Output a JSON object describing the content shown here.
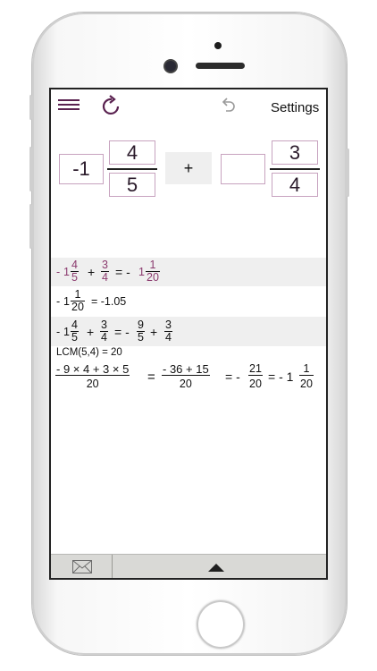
{
  "topbar": {
    "settings_label": "Settings"
  },
  "input": {
    "whole1": "-1",
    "num1": "4",
    "den1": "5",
    "operator": "+",
    "whole2": "",
    "num2": "3",
    "den2": "4"
  },
  "result": {
    "row1": {
      "minus": "-",
      "w": "1",
      "n1": "4",
      "d1": "5",
      "plus": "+",
      "n2": "3",
      "d2": "4",
      "eq": "= -",
      "rw": "1",
      "rn": "1",
      "rd": "20"
    },
    "row2": {
      "minus": "-",
      "w": "1",
      "n": "1",
      "d": "20",
      "eq": "= -1.05"
    },
    "row3": {
      "minus": "-",
      "w": "1",
      "n1": "4",
      "d1": "5",
      "plus": "+",
      "n2": "3",
      "d2": "4",
      "eq": "= -",
      "rn1": "9",
      "rd1": "5",
      "plus2": "+",
      "rn2": "3",
      "rd2": "4"
    },
    "lcm": "LCM(5,4) = 20",
    "row5": {
      "n1": "- 9 × 4 + 3 × 5",
      "d1": "20",
      "eq1": "=",
      "n2": "- 36 + 15",
      "d2": "20",
      "eq2": "= -",
      "n3": "21",
      "d3": "20",
      "eq3": "= - 1",
      "n4": "1",
      "d4": "20"
    }
  },
  "colors": {
    "accent": "#5a2250",
    "purple_text": "#8b3a6e",
    "box_border": "#c7a3bf"
  },
  "icons": {
    "menu": "menu-icon",
    "refresh": "refresh-icon",
    "undo": "undo-icon",
    "mail": "mail-icon",
    "expand": "chevron-up-icon"
  }
}
